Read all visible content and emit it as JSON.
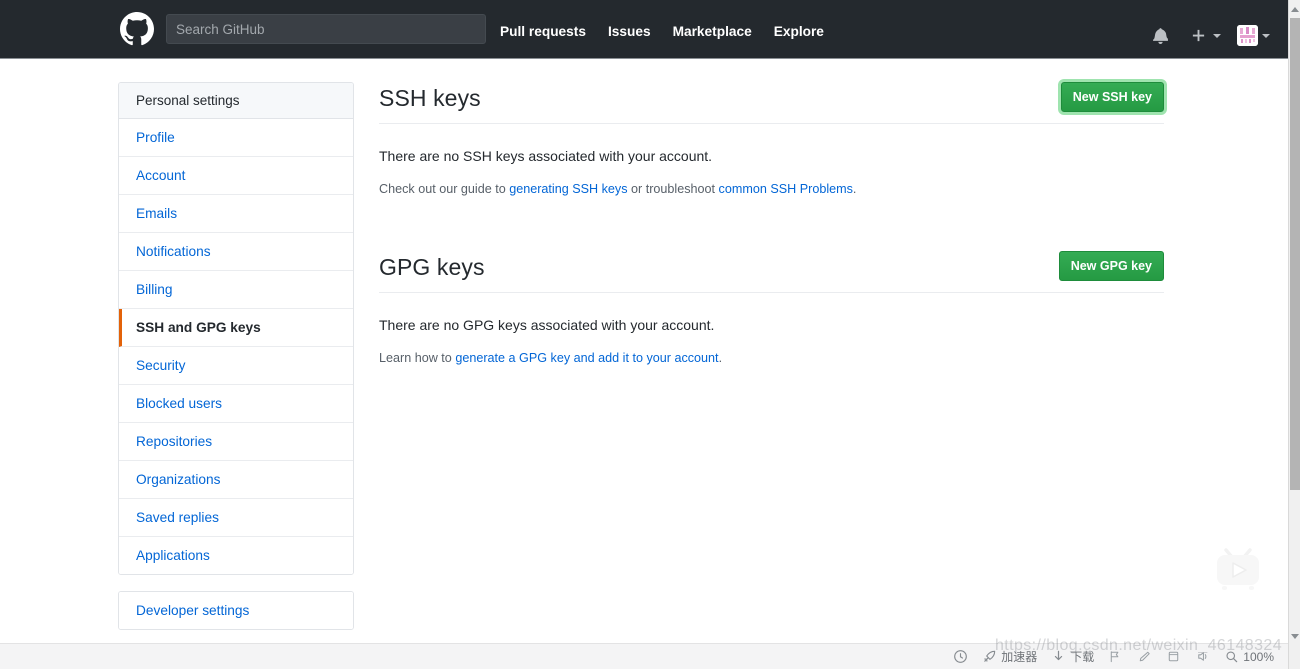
{
  "header": {
    "logo_icon": "github-mark-icon",
    "search": {
      "placeholder": "Search GitHub",
      "value": ""
    },
    "nav": [
      {
        "label": "Pull requests"
      },
      {
        "label": "Issues"
      },
      {
        "label": "Marketplace"
      },
      {
        "label": "Explore"
      }
    ],
    "right": {
      "notifications_icon": "bell-icon",
      "create_new_icon": "plus-icon",
      "create_new_caret_icon": "chevron-down-icon",
      "avatar_icon": "user-avatar",
      "avatar_caret_icon": "chevron-down-icon"
    },
    "background_color": "#24292e"
  },
  "sidebar": {
    "section_title": "Personal settings",
    "items": [
      {
        "label": "Profile",
        "active": false
      },
      {
        "label": "Account",
        "active": false
      },
      {
        "label": "Emails",
        "active": false
      },
      {
        "label": "Notifications",
        "active": false
      },
      {
        "label": "Billing",
        "active": false
      },
      {
        "label": "SSH and GPG keys",
        "active": true
      },
      {
        "label": "Security",
        "active": false
      },
      {
        "label": "Blocked users",
        "active": false
      },
      {
        "label": "Repositories",
        "active": false
      },
      {
        "label": "Organizations",
        "active": false
      },
      {
        "label": "Saved replies",
        "active": false
      },
      {
        "label": "Applications",
        "active": false
      }
    ],
    "developer_section": {
      "label": "Developer settings"
    },
    "active_accent_color": "#e36209",
    "link_color": "#0366d6"
  },
  "main": {
    "ssh": {
      "title": "SSH keys",
      "button_label": "New SSH key",
      "empty_text": "There are no SSH keys associated with your account.",
      "help_prefix": "Check out our guide to ",
      "help_link1": "generating SSH keys",
      "help_middle": " or troubleshoot ",
      "help_link2": "common SSH Problems",
      "help_suffix": "."
    },
    "gpg": {
      "title": "GPG keys",
      "button_label": "New GPG key",
      "empty_text": "There are no GPG keys associated with your account.",
      "help_prefix": "Learn how to ",
      "help_link1": "generate a GPG key and add it to your account",
      "help_suffix": "."
    },
    "button_color": "#28a745"
  },
  "float_widget": {
    "icon": "video-play-icon"
  },
  "statusbar": {
    "items": [
      {
        "icon": "shield-clock-icon",
        "label": ""
      },
      {
        "icon": "rocket-icon",
        "label": "加速器"
      },
      {
        "icon": "download-arrow-icon",
        "label": "下载"
      },
      {
        "icon": "flag-icon",
        "label": ""
      },
      {
        "icon": "edit-pen-icon",
        "label": ""
      },
      {
        "icon": "window-icon",
        "label": ""
      },
      {
        "icon": "sound-icon",
        "label": ""
      },
      {
        "icon": "zoom-search-icon",
        "label": "100%"
      }
    ]
  },
  "watermark": {
    "text": "https://blog.csdn.net/weixin_46148324"
  },
  "scrollbar": {
    "up_arrow_icon": "caret-up-icon",
    "down_arrow_icon": "caret-down-icon"
  }
}
